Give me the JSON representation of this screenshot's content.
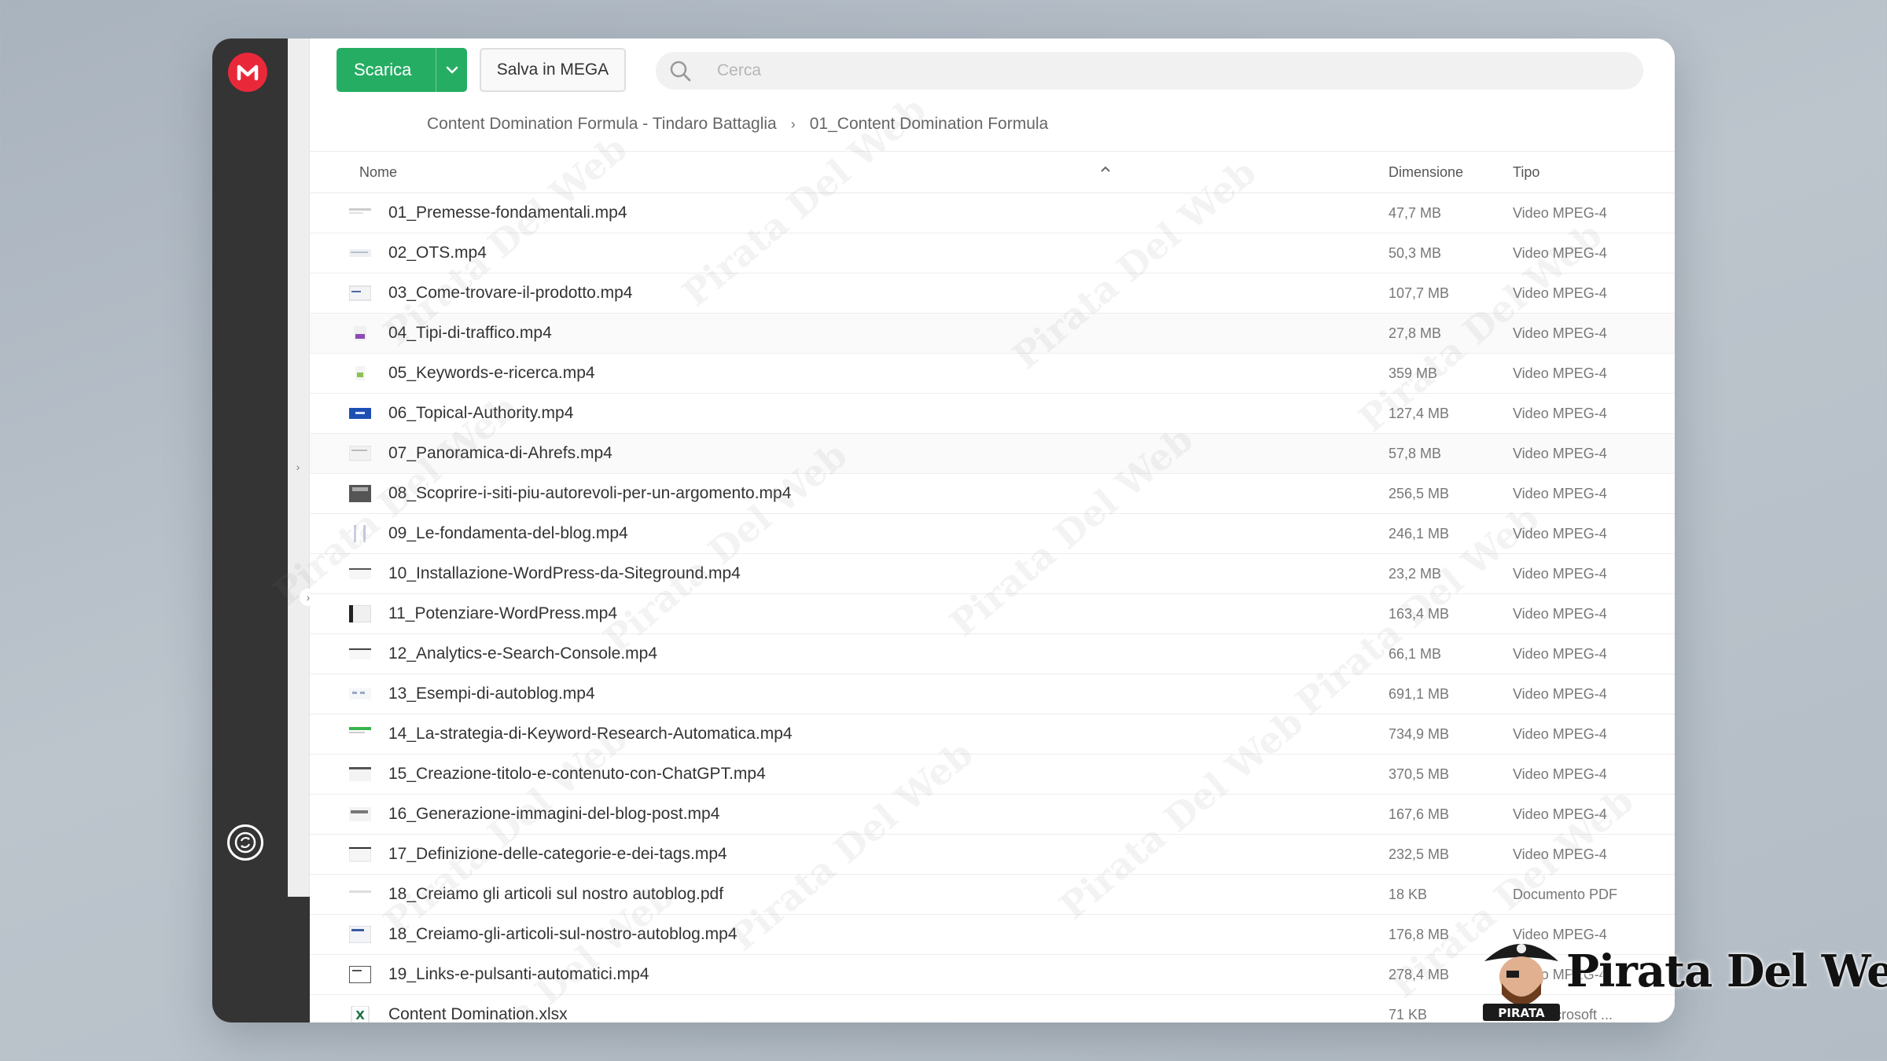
{
  "toolbar": {
    "download_label": "Scarica",
    "save_label": "Salva in MEGA",
    "search_placeholder": "Cerca"
  },
  "breadcrumb": {
    "items": [
      "Content Domination Formula - Tindaro Battaglia",
      "01_Content Domination Formula"
    ]
  },
  "table": {
    "headers": {
      "name": "Nome",
      "size": "Dimensione",
      "type": "Tipo"
    },
    "rows": [
      {
        "name": "01_Premesse-fondamentali.mp4",
        "size": "47,7 MB",
        "type": "Video MPEG-4"
      },
      {
        "name": "02_OTS.mp4",
        "size": "50,3 MB",
        "type": "Video MPEG-4"
      },
      {
        "name": "03_Come-trovare-il-prodotto.mp4",
        "size": "107,7 MB",
        "type": "Video MPEG-4"
      },
      {
        "name": "04_Tipi-di-traffico.mp4",
        "size": "27,8 MB",
        "type": "Video MPEG-4"
      },
      {
        "name": "05_Keywords-e-ricerca.mp4",
        "size": "359 MB",
        "type": "Video MPEG-4"
      },
      {
        "name": "06_Topical-Authority.mp4",
        "size": "127,4 MB",
        "type": "Video MPEG-4"
      },
      {
        "name": "07_Panoramica-di-Ahrefs.mp4",
        "size": "57,8 MB",
        "type": "Video MPEG-4"
      },
      {
        "name": "08_Scoprire-i-siti-piu-autorevoli-per-un-argomento.mp4",
        "size": "256,5 MB",
        "type": "Video MPEG-4"
      },
      {
        "name": "09_Le-fondamenta-del-blog.mp4",
        "size": "246,1 MB",
        "type": "Video MPEG-4"
      },
      {
        "name": "10_Installazione-WordPress-da-Siteground.mp4",
        "size": "23,2 MB",
        "type": "Video MPEG-4"
      },
      {
        "name": "11_Potenziare-WordPress.mp4",
        "size": "163,4 MB",
        "type": "Video MPEG-4"
      },
      {
        "name": "12_Analytics-e-Search-Console.mp4",
        "size": "66,1 MB",
        "type": "Video MPEG-4"
      },
      {
        "name": "13_Esempi-di-autoblog.mp4",
        "size": "691,1 MB",
        "type": "Video MPEG-4"
      },
      {
        "name": "14_La-strategia-di-Keyword-Research-Automatica.mp4",
        "size": "734,9 MB",
        "type": "Video MPEG-4"
      },
      {
        "name": "15_Creazione-titolo-e-contenuto-con-ChatGPT.mp4",
        "size": "370,5 MB",
        "type": "Video MPEG-4"
      },
      {
        "name": "16_Generazione-immagini-del-blog-post.mp4",
        "size": "167,6 MB",
        "type": "Video MPEG-4"
      },
      {
        "name": "17_Definizione-delle-categorie-e-dei-tags.mp4",
        "size": "232,5 MB",
        "type": "Video MPEG-4"
      },
      {
        "name": "18_Creiamo gli articoli sul nostro autoblog.pdf",
        "size": "18 KB",
        "type": "Documento PDF"
      },
      {
        "name": "18_Creiamo-gli-articoli-sul-nostro-autoblog.mp4",
        "size": "176,8 MB",
        "type": "Video MPEG-4"
      },
      {
        "name": "19_Links-e-pulsanti-automatici.mp4",
        "size": "278,4 MB",
        "type": "Video MPEG-4"
      },
      {
        "name": "Content Domination.xlsx",
        "size": "71 KB",
        "type": "o di Microsoft ..."
      }
    ]
  },
  "watermark": {
    "text": "Pirata Del Web",
    "badge_text": "PIRATA"
  },
  "colors": {
    "accent_green": "#26ad64",
    "mega_red": "#e9293a",
    "sidebar": "#343434"
  }
}
